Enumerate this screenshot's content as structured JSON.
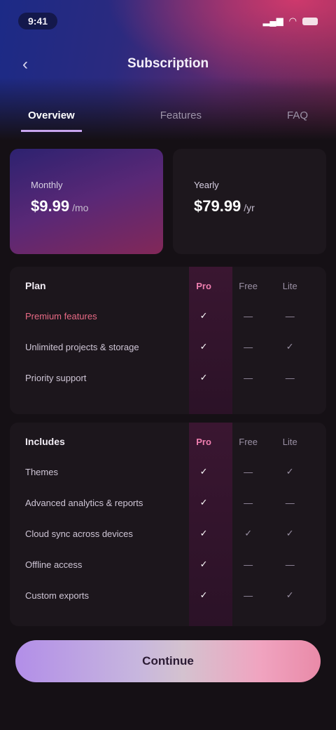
{
  "status": {
    "time": "9:41"
  },
  "header": {
    "title": "Subscription",
    "back_label": "‹"
  },
  "tabs": [
    {
      "label": "Overview",
      "active": true
    },
    {
      "label": "Features",
      "active": false
    },
    {
      "label": "FAQ",
      "active": false
    }
  ],
  "cards": [
    {
      "label": "Monthly",
      "value": "$9.99",
      "unit": "/mo"
    },
    {
      "label": "Yearly",
      "value": "$79.99",
      "unit": "/yr"
    }
  ],
  "table1": {
    "header": [
      "Plan",
      "Pro",
      "Free",
      "Lite"
    ],
    "rows": [
      {
        "name": "Premium features",
        "accent": true,
        "pro": "✓",
        "free": "—",
        "lite": "—"
      },
      {
        "name": "Unlimited projects & storage",
        "accent": false,
        "pro": "✓",
        "free": "—",
        "lite": "✓"
      },
      {
        "name": "Priority support",
        "accent": false,
        "pro": "✓",
        "free": "—",
        "lite": "—"
      }
    ]
  },
  "table2": {
    "header": [
      "Includes",
      "Pro",
      "Free",
      "Lite"
    ],
    "rows": [
      {
        "name": "Themes",
        "pro": "✓",
        "free": "—",
        "lite": "✓"
      },
      {
        "name": "Advanced analytics & reports",
        "pro": "✓",
        "free": "—",
        "lite": "—"
      },
      {
        "name": "Cloud sync across devices",
        "pro": "✓",
        "free": "✓",
        "lite": "✓"
      },
      {
        "name": "Offline access",
        "pro": "✓",
        "free": "—",
        "lite": "—"
      },
      {
        "name": "Custom exports",
        "pro": "✓",
        "free": "—",
        "lite": "✓"
      }
    ]
  },
  "cta": {
    "label": "Continue"
  },
  "colors": {
    "accent": "#c9a6f0",
    "pink": "#f08fb6",
    "background": "#151015"
  }
}
